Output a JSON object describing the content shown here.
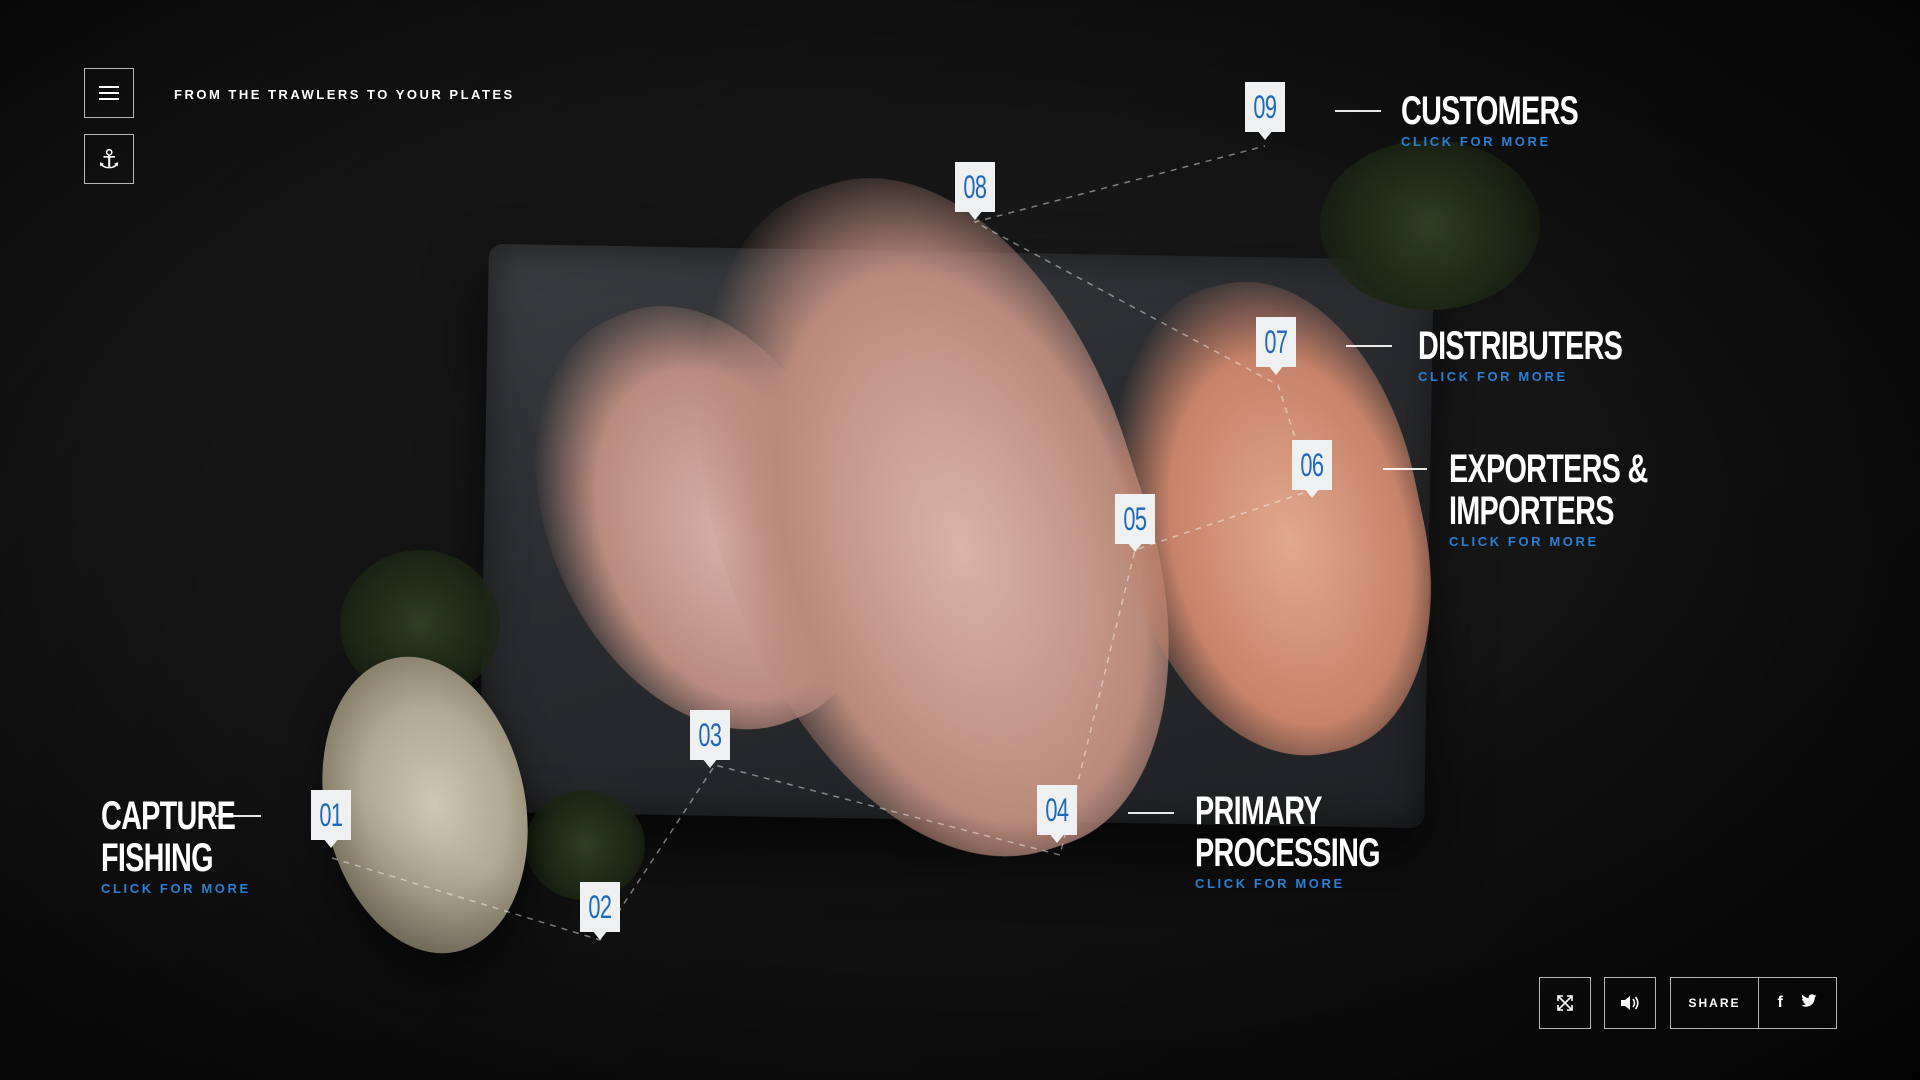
{
  "header": {
    "tagline": "FROM THE TRAWLERS TO YOUR PLATES"
  },
  "icons": {
    "menu": "menu-icon",
    "anchor": "anchor-icon",
    "fullscreen": "fullscreen-icon",
    "sound": "speaker-icon",
    "facebook": "facebook-icon",
    "twitter": "twitter-icon"
  },
  "steps": [
    {
      "num": "01",
      "title_lines": [
        "CAPTURE",
        "FISHING"
      ],
      "cta": "CLICK FOR MORE"
    },
    {
      "num": "02"
    },
    {
      "num": "03"
    },
    {
      "num": "04",
      "title_lines": [
        "PRIMARY",
        "PROCESSING"
      ],
      "cta": "CLICK FOR MORE"
    },
    {
      "num": "05"
    },
    {
      "num": "06",
      "title_lines": [
        "EXPORTERS &",
        "IMPORTERS"
      ],
      "cta": "CLICK FOR MORE"
    },
    {
      "num": "07",
      "title_lines": [
        "DISTRIBUTERS"
      ],
      "cta": "CLICK FOR MORE"
    },
    {
      "num": "08"
    },
    {
      "num": "09",
      "title_lines": [
        "CUSTOMERS"
      ],
      "cta": "CLICK FOR MORE"
    }
  ],
  "footer": {
    "share_label": "SHARE",
    "facebook_glyph": "f",
    "twitter_glyph": "t"
  },
  "colors": {
    "accent": "#2b7fd3",
    "marker_bg": "#eef0f2",
    "marker_text": "#1f69b8"
  }
}
